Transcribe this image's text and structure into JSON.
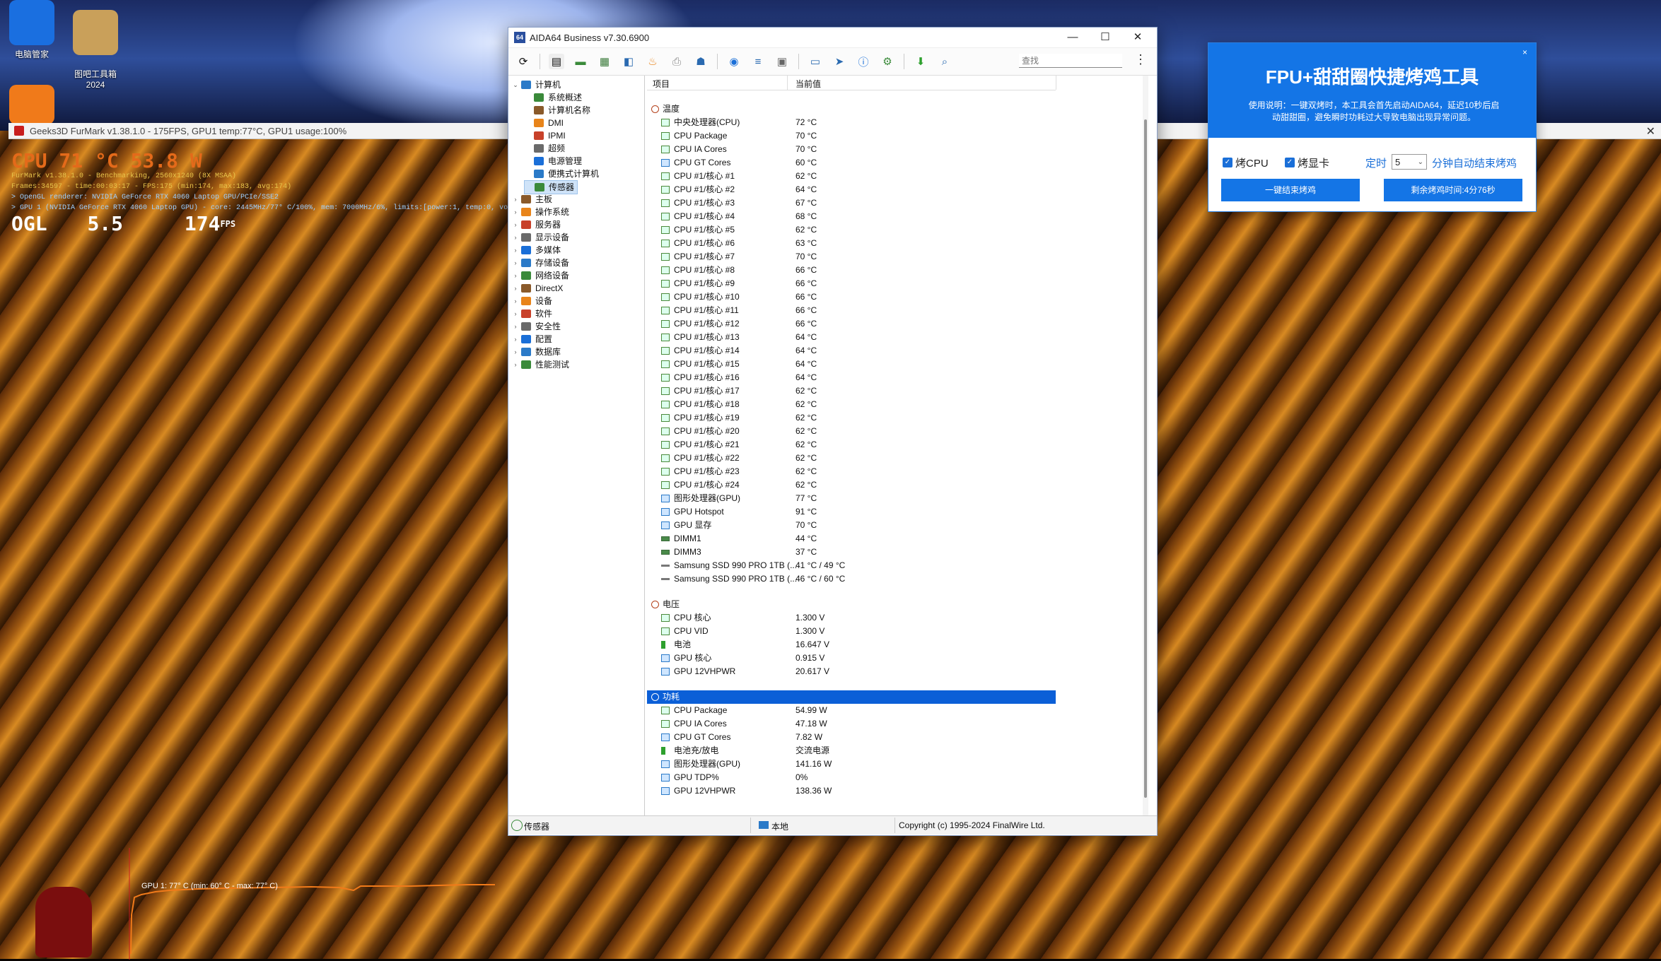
{
  "desktop": {
    "icons": [
      {
        "label": "电脑管家"
      },
      {
        "label": "图吧工具箱\n2024"
      }
    ]
  },
  "furmark": {
    "window_title": "Geeks3D FurMark v1.38.1.0 - 175FPS, GPU1 temp:77°C, GPU1 usage:100%",
    "overlay_cpu": "CPU   71 °C   53.8 W",
    "overlay_lines": [
      "FurMark v1.38.1.0 - Benchmarking, 2560x1240 (8X MSAA)",
      "Frames:34597 - time:00:03:17 - FPS:175 (min:174, max:183, avg:174)",
      "> OpenGL renderer: NVIDIA GeForce RTX 4060 Laptop GPU/PCIe/SSE2",
      "> GPU 1 (NVIDIA GeForce RTX 4060 Laptop GPU) - core: 2445MHz/77° C/100%, mem: 7000MHz/6%, limits:[power:1, temp:0, volt:0, OV:0]"
    ],
    "overlay_ogl": "OGL",
    "overlay_ogl_ver": "5.5",
    "overlay_fps_value": "174",
    "overlay_fps_unit": "FPS",
    "graph_label": "GPU 1: 77° C (min: 60° C - max: 77° C)"
  },
  "aida": {
    "title": "AIDA64 Business v7.30.6900",
    "search_placeholder": "查找",
    "tree": [
      {
        "label": "计算机",
        "level": 0,
        "expanded": true
      },
      {
        "label": "系统概述",
        "level": 1
      },
      {
        "label": "计算机名称",
        "level": 1
      },
      {
        "label": "DMI",
        "level": 1
      },
      {
        "label": "IPMI",
        "level": 1
      },
      {
        "label": "超频",
        "level": 1
      },
      {
        "label": "电源管理",
        "level": 1
      },
      {
        "label": "便携式计算机",
        "level": 1
      },
      {
        "label": "传感器",
        "level": 1,
        "selected": true
      },
      {
        "label": "主板",
        "level": 0
      },
      {
        "label": "操作系统",
        "level": 0
      },
      {
        "label": "服务器",
        "level": 0
      },
      {
        "label": "显示设备",
        "level": 0
      },
      {
        "label": "多媒体",
        "level": 0
      },
      {
        "label": "存储设备",
        "level": 0
      },
      {
        "label": "网络设备",
        "level": 0
      },
      {
        "label": "DirectX",
        "level": 0
      },
      {
        "label": "设备",
        "level": 0
      },
      {
        "label": "软件",
        "level": 0
      },
      {
        "label": "安全性",
        "level": 0
      },
      {
        "label": "配置",
        "level": 0
      },
      {
        "label": "数据库",
        "level": 0
      },
      {
        "label": "性能测试",
        "level": 0
      }
    ],
    "columns": {
      "item": "项目",
      "value": "当前值"
    },
    "groups": [
      {
        "name": "温度",
        "rows": [
          {
            "label": "中央处理器(CPU)",
            "value": "72 °C",
            "kind": "cpu"
          },
          {
            "label": "CPU Package",
            "value": "70 °C",
            "kind": "cpu"
          },
          {
            "label": "CPU IA Cores",
            "value": "70 °C",
            "kind": "cpu"
          },
          {
            "label": "CPU GT Cores",
            "value": "60 °C",
            "kind": "gpu"
          },
          {
            "label": "CPU #1/核心 #1",
            "value": "62 °C",
            "kind": "cpu"
          },
          {
            "label": "CPU #1/核心 #2",
            "value": "64 °C",
            "kind": "cpu"
          },
          {
            "label": "CPU #1/核心 #3",
            "value": "67 °C",
            "kind": "cpu"
          },
          {
            "label": "CPU #1/核心 #4",
            "value": "68 °C",
            "kind": "cpu"
          },
          {
            "label": "CPU #1/核心 #5",
            "value": "62 °C",
            "kind": "cpu"
          },
          {
            "label": "CPU #1/核心 #6",
            "value": "63 °C",
            "kind": "cpu"
          },
          {
            "label": "CPU #1/核心 #7",
            "value": "70 °C",
            "kind": "cpu"
          },
          {
            "label": "CPU #1/核心 #8",
            "value": "66 °C",
            "kind": "cpu"
          },
          {
            "label": "CPU #1/核心 #9",
            "value": "66 °C",
            "kind": "cpu"
          },
          {
            "label": "CPU #1/核心 #10",
            "value": "66 °C",
            "kind": "cpu"
          },
          {
            "label": "CPU #1/核心 #11",
            "value": "66 °C",
            "kind": "cpu"
          },
          {
            "label": "CPU #1/核心 #12",
            "value": "66 °C",
            "kind": "cpu"
          },
          {
            "label": "CPU #1/核心 #13",
            "value": "64 °C",
            "kind": "cpu"
          },
          {
            "label": "CPU #1/核心 #14",
            "value": "64 °C",
            "kind": "cpu"
          },
          {
            "label": "CPU #1/核心 #15",
            "value": "64 °C",
            "kind": "cpu"
          },
          {
            "label": "CPU #1/核心 #16",
            "value": "64 °C",
            "kind": "cpu"
          },
          {
            "label": "CPU #1/核心 #17",
            "value": "62 °C",
            "kind": "cpu"
          },
          {
            "label": "CPU #1/核心 #18",
            "value": "62 °C",
            "kind": "cpu"
          },
          {
            "label": "CPU #1/核心 #19",
            "value": "62 °C",
            "kind": "cpu"
          },
          {
            "label": "CPU #1/核心 #20",
            "value": "62 °C",
            "kind": "cpu"
          },
          {
            "label": "CPU #1/核心 #21",
            "value": "62 °C",
            "kind": "cpu"
          },
          {
            "label": "CPU #1/核心 #22",
            "value": "62 °C",
            "kind": "cpu"
          },
          {
            "label": "CPU #1/核心 #23",
            "value": "62 °C",
            "kind": "cpu"
          },
          {
            "label": "CPU #1/核心 #24",
            "value": "62 °C",
            "kind": "cpu"
          },
          {
            "label": "图形处理器(GPU)",
            "value": "77 °C",
            "kind": "gpu"
          },
          {
            "label": "GPU Hotspot",
            "value": "91 °C",
            "kind": "gpu"
          },
          {
            "label": "GPU 显存",
            "value": "70 °C",
            "kind": "gpu"
          },
          {
            "label": "DIMM1",
            "value": "44 °C",
            "kind": "mem"
          },
          {
            "label": "DIMM3",
            "value": "37 °C",
            "kind": "mem"
          },
          {
            "label": "Samsung SSD 990 PRO 1TB (...",
            "value": "41 °C / 49 °C",
            "kind": "ssd"
          },
          {
            "label": "Samsung SSD 990 PRO 1TB (...",
            "value": "46 °C / 60 °C",
            "kind": "ssd"
          }
        ]
      },
      {
        "name": "电压",
        "rows": [
          {
            "label": "CPU 核心",
            "value": "1.300 V",
            "kind": "cpu"
          },
          {
            "label": "CPU VID",
            "value": "1.300 V",
            "kind": "cpu"
          },
          {
            "label": "电池",
            "value": "16.647 V",
            "kind": "bat"
          },
          {
            "label": "GPU 核心",
            "value": "0.915 V",
            "kind": "gpu"
          },
          {
            "label": "GPU 12VHPWR",
            "value": "20.617 V",
            "kind": "gpu"
          }
        ]
      },
      {
        "name": "功耗",
        "selected": true,
        "rows": [
          {
            "label": "CPU Package",
            "value": "54.99 W",
            "kind": "cpu"
          },
          {
            "label": "CPU IA Cores",
            "value": "47.18 W",
            "kind": "cpu"
          },
          {
            "label": "CPU GT Cores",
            "value": "7.82 W",
            "kind": "gpu"
          },
          {
            "label": "电池充/放电",
            "value": "交流电源",
            "kind": "bat"
          },
          {
            "label": "图形处理器(GPU)",
            "value": "141.16 W",
            "kind": "gpu"
          },
          {
            "label": "GPU TDP%",
            "value": "0%",
            "kind": "gpu"
          },
          {
            "label": "GPU 12VHPWR",
            "value": "138.36 W",
            "kind": "gpu"
          }
        ]
      }
    ],
    "status": {
      "left": "传感器",
      "middle": "本地",
      "right": "Copyright (c) 1995-2024 FinalWire Ltd."
    }
  },
  "fpu": {
    "title": "FPU+甜甜圈快捷烤鸡工具",
    "desc": "使用说明：一键双烤时，本工具会首先启动AIDA64，延迟10秒后启动甜甜圈，避免瞬时功耗过大导致电脑出现异常问题。",
    "close": "×",
    "opt_cpu": "烤CPU",
    "opt_gpu": "烤显卡",
    "timer_label": "定时",
    "timer_value": "5",
    "timer_suffix": "分钟自动结束烤鸡",
    "btn_stop": "一键结束烤鸡",
    "btn_countdown": "剩余烤鸡时间:4分76秒"
  },
  "colors": {
    "selection": "#0b5fd7",
    "fpu_blue": "#1475e6",
    "overlay_orange": "#e46a1a"
  }
}
